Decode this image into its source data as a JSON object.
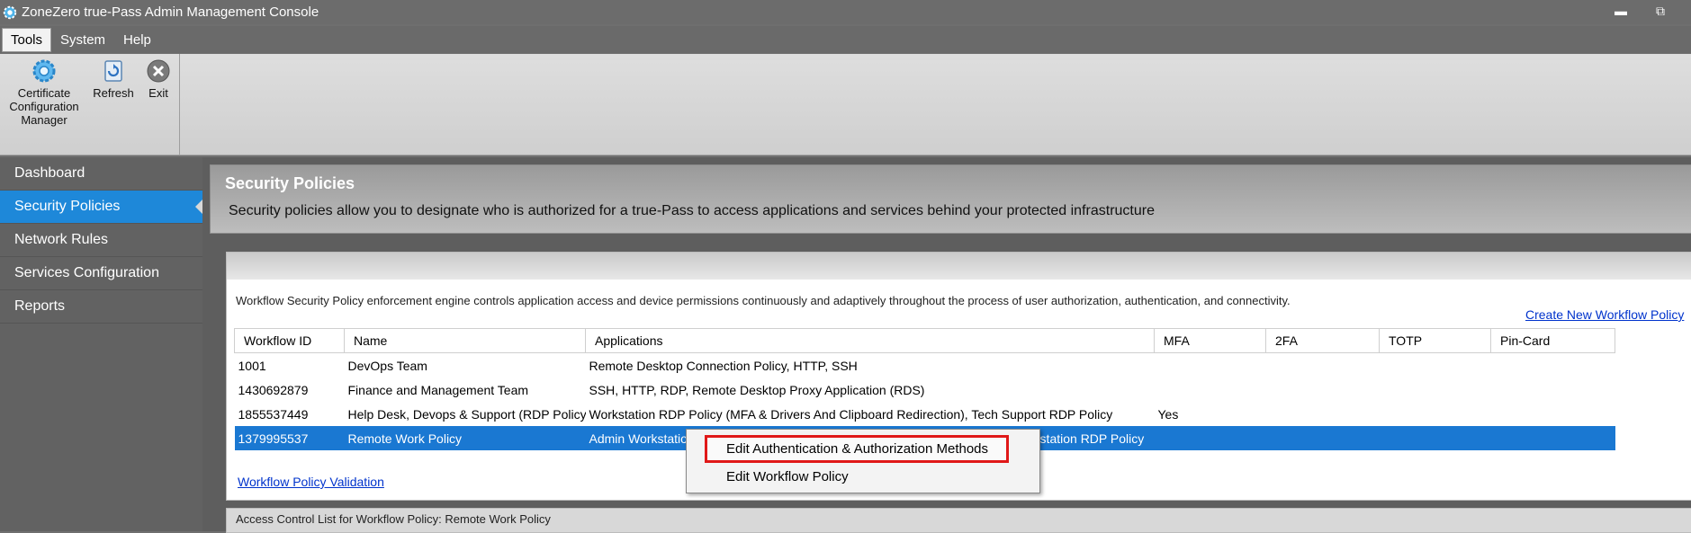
{
  "window": {
    "title": "ZoneZero true-Pass Admin Management Console",
    "minimize_icon": "minimize-icon",
    "restore_icon": "restore-icon"
  },
  "menu": {
    "items": [
      {
        "label": "Tools"
      },
      {
        "label": "System"
      },
      {
        "label": "Help"
      }
    ]
  },
  "toolbar": {
    "cert_label_1": "Certificate",
    "cert_label_2": "Configuration",
    "cert_label_3": "Manager",
    "refresh_label": "Refresh",
    "exit_label": "Exit"
  },
  "sidebar": {
    "items": [
      {
        "label": "Dashboard"
      },
      {
        "label": "Security Policies"
      },
      {
        "label": "Network Rules"
      },
      {
        "label": "Services Configuration"
      },
      {
        "label": "Reports"
      }
    ],
    "selected_index": 1
  },
  "header": {
    "title": "Security Policies",
    "description": "Security policies allow you to designate who is authorized for a true-Pass to access applications and services behind your protected infrastructure"
  },
  "panel": {
    "description": "Workflow Security Policy enforcement engine controls application access and device permissions continuously and adaptively throughout the process of user authorization, authentication, and connectivity.",
    "create_link": "Create New Workflow Policy",
    "validate_link": "Workflow Policy Validation"
  },
  "table": {
    "columns": [
      "Workflow ID",
      "Name",
      "Applications",
      "MFA",
      "2FA",
      "TOTP",
      "Pin-Card"
    ],
    "rows": [
      {
        "id": "1001",
        "name": "DevOps Team",
        "apps": "Remote Desktop Connection Policy, HTTP, SSH",
        "mfa": "",
        "tfa": "",
        "totp": "",
        "pin": ""
      },
      {
        "id": "1430692879",
        "name": "Finance and Management Team",
        "apps": "SSH, HTTP, RDP, Remote Desktop Proxy Application (RDS)",
        "mfa": "",
        "tfa": "",
        "totp": "",
        "pin": ""
      },
      {
        "id": "1855537449",
        "name": "Help Desk, Devops & Support  (RDP Policy)",
        "apps": "Workstation RDP Policy (MFA & Drivers And Clipboard Redirection), Tech Support RDP Policy",
        "mfa": "Yes",
        "tfa": "",
        "totp": "",
        "pin": ""
      },
      {
        "id": "1379995537",
        "name": "Remote Work Policy",
        "apps": "Admin Workstation RDP Policy (MFA & Drivers And Clipboard Redirection), Workstation RDP Policy",
        "mfa": "",
        "tfa": "",
        "totp": "",
        "pin": ""
      }
    ],
    "selected_row": 3
  },
  "acl": {
    "label": "Access Control List for Workflow Policy: Remote Work Policy"
  },
  "context_menu": {
    "items": [
      {
        "label": "Edit Authentication & Authorization Methods",
        "highlighted": true
      },
      {
        "label": "Edit Workflow Policy",
        "highlighted": false
      }
    ]
  },
  "colors": {
    "selection": "#1a78d2",
    "sidebar_selected": "#1e88d9",
    "highlight_border": "#e01818",
    "link": "#0033cc"
  }
}
